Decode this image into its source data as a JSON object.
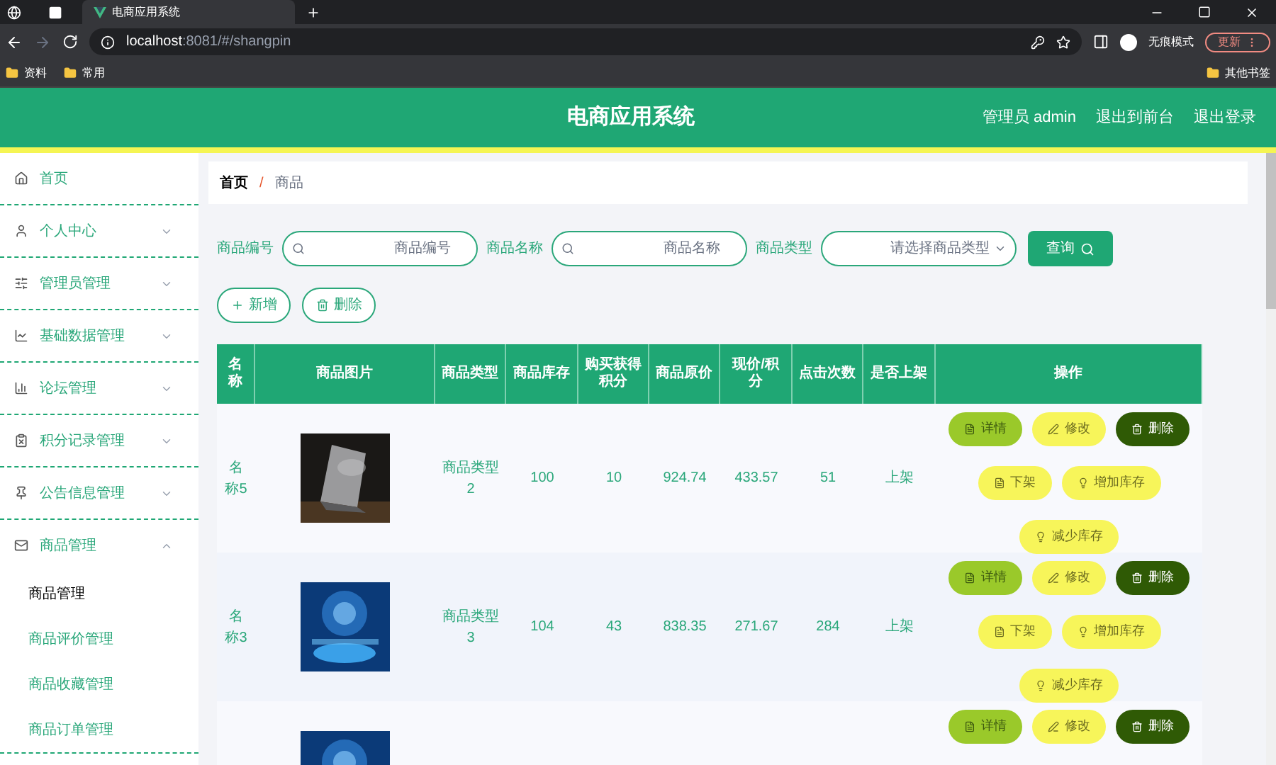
{
  "browser": {
    "tabs": [
      {
        "title": "电商应用系统",
        "selected": true
      }
    ],
    "address_host": "localhost",
    "address_path": ":8081/#/shangpin",
    "incognito": "无痕模式",
    "update": "更新",
    "bookmarks": [
      "资料",
      "常用"
    ],
    "other_bookmarks": "其他书签"
  },
  "header": {
    "title": "电商应用系统",
    "links": [
      "管理员 admin",
      "退出到前台",
      "退出登录"
    ]
  },
  "sidebar": {
    "items": [
      {
        "label": "首页"
      },
      {
        "label": "个人中心",
        "expanded": false
      },
      {
        "label": "管理员管理",
        "expanded": false
      },
      {
        "label": "基础数据管理",
        "expanded": false
      },
      {
        "label": "论坛管理",
        "expanded": false
      },
      {
        "label": "积分记录管理",
        "expanded": false
      },
      {
        "label": "公告信息管理",
        "expanded": false
      },
      {
        "label": "商品管理",
        "expanded": true,
        "children": [
          {
            "label": "商品管理",
            "selected": true
          },
          {
            "label": "商品评价管理",
            "selected": false
          },
          {
            "label": "商品收藏管理",
            "selected": false
          },
          {
            "label": "商品订单管理",
            "selected": false
          }
        ]
      }
    ]
  },
  "breadcrumb": {
    "items": [
      "首页",
      "商品"
    ],
    "separator": "/"
  },
  "search": {
    "fields": [
      {
        "label": "商品编号",
        "placeholder": "商品编号",
        "kind": "input"
      },
      {
        "label": "商品名称",
        "placeholder": "商品名称",
        "kind": "input"
      },
      {
        "label": "商品类型",
        "placeholder": "请选择商品类型",
        "kind": "select"
      }
    ],
    "button": "查询"
  },
  "toolbar": [
    {
      "label": "新增",
      "kind": "add"
    },
    {
      "label": "删除",
      "kind": "delete"
    }
  ],
  "table": {
    "columns": [
      "名称",
      "商品图片",
      "商品类型",
      "商品库存",
      "购买获得积分",
      "商品原价",
      "现价/积分",
      "点击次数",
      "是否上架",
      "操作"
    ],
    "rows": [
      {
        "name": "名称5",
        "type": "商品类型2",
        "stock": "100",
        "points": "10",
        "price": "924.74",
        "now": "433.57",
        "clicks": "51",
        "status": "上架",
        "actions": [
          {
            "label": "详情",
            "kind": "detail"
          },
          {
            "label": "修改",
            "kind": "edit"
          },
          {
            "label": "删除",
            "kind": "delete"
          },
          {
            "label": "下架",
            "kind": "off"
          },
          {
            "label": "增加库存",
            "kind": "stock"
          },
          {
            "label": "减少库存",
            "kind": "stock"
          }
        ]
      },
      {
        "name": "名称3",
        "type": "商品类型3",
        "stock": "104",
        "points": "43",
        "price": "838.35",
        "now": "271.67",
        "clicks": "284",
        "status": "上架",
        "actions": [
          {
            "label": "详情",
            "kind": "detail"
          },
          {
            "label": "修改",
            "kind": "edit"
          },
          {
            "label": "删除",
            "kind": "delete"
          },
          {
            "label": "下架",
            "kind": "off"
          },
          {
            "label": "增加库存",
            "kind": "stock"
          },
          {
            "label": "减少库存",
            "kind": "stock"
          }
        ]
      },
      {
        "actions": [
          {
            "label": "详情",
            "kind": "detail"
          },
          {
            "label": "修改",
            "kind": "edit"
          },
          {
            "label": "删除",
            "kind": "delete"
          }
        ]
      }
    ]
  }
}
